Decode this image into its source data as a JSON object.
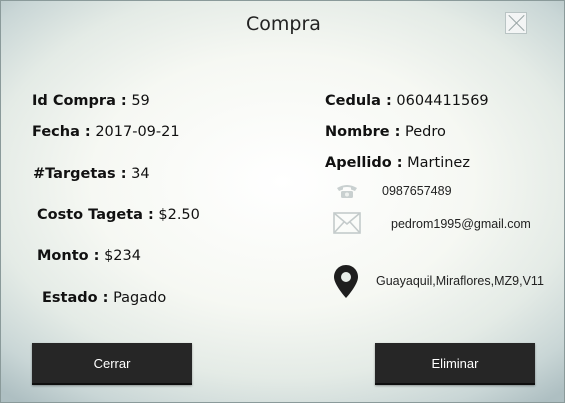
{
  "dialog": {
    "title": "Compra"
  },
  "left": {
    "id_label": "Id Compra :",
    "id_value": "59",
    "fecha_label": "Fecha :",
    "fecha_value": "2017-09-21",
    "targetas_label": "#Targetas :",
    "targetas_value": "34",
    "costo_label": "Costo Tageta :",
    "costo_value": "$2.50",
    "monto_label": "Monto :",
    "monto_value": "$234",
    "estado_label": "Estado :",
    "estado_value": "Pagado"
  },
  "right": {
    "cedula_label": "Cedula :",
    "cedula_value": "0604411569",
    "nombre_label": "Nombre :",
    "nombre_value": "Pedro",
    "apellido_label": "Apellido :",
    "apellido_value": "Martinez"
  },
  "contact": {
    "phone": "0987657489",
    "email": "pedrom1995@gmail.com",
    "address": "Guayaquil,Miraflores,MZ9,V11",
    "icons": [
      "phone-icon",
      "email-icon",
      "location-pin-icon"
    ]
  },
  "buttons": {
    "close_label": "Cerrar",
    "delete_label": "Eliminar"
  }
}
